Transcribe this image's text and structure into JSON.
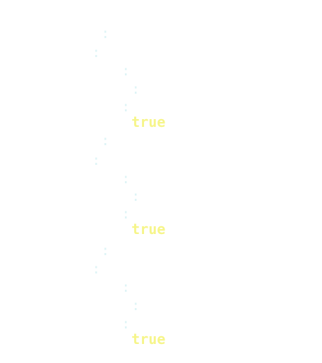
{
  "editor": {
    "lines": [
      {
        "colon": ":",
        "value": ""
      },
      {
        "colon": ":",
        "value": ""
      },
      {
        "colon": ":",
        "value": ""
      },
      {
        "colon": ":",
        "value": ""
      },
      {
        "colon": ":",
        "value": "true"
      },
      {
        "colon": ":",
        "value": ""
      },
      {
        "colon": ":",
        "value": ""
      },
      {
        "colon": ":",
        "value": ""
      },
      {
        "colon": ":",
        "value": ""
      },
      {
        "colon": ":",
        "value": "true"
      },
      {
        "colon": ":",
        "value": ""
      },
      {
        "colon": ":",
        "value": ""
      },
      {
        "colon": ":",
        "value": ""
      },
      {
        "colon": ":",
        "value": ""
      },
      {
        "colon": ":",
        "value": "true"
      }
    ]
  },
  "colors": {
    "background": "#ffffff",
    "punctuation": "#dff4f6",
    "boolean": "#f6f58a"
  }
}
